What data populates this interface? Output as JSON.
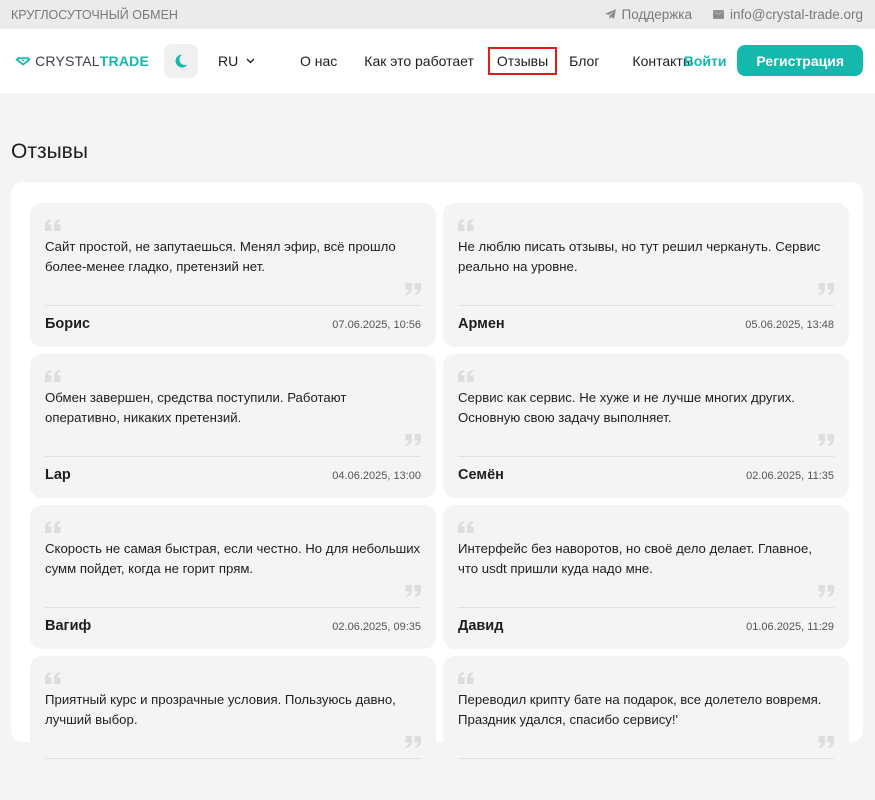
{
  "topbar": {
    "tagline": "КРУГЛОСУТОЧНЫЙ ОБМЕН",
    "support_label": "Поддержка",
    "email": "info@crystal-trade.org"
  },
  "header": {
    "brand_part1": "CRYSTAL",
    "brand_part2": "TRADE",
    "language": "RU",
    "nav": [
      "О нас",
      "Как это работает",
      "Отзывы",
      "Блог",
      "Контакты"
    ],
    "active_nav_index": 2,
    "login_label": "Войти",
    "register_label": "Регистрация"
  },
  "colors": {
    "accent": "#14b8ad",
    "highlight_border": "#e01b1b"
  },
  "page": {
    "title": "Отзывы"
  },
  "reviews": [
    {
      "text": "Сайт простой, не запутаешься. Менял эфир, всё прошло более-менее гладко, претензий нет.",
      "author": "Борис",
      "date": "07.06.2025, 10:56"
    },
    {
      "text": "Не люблю писать отзывы, но тут решил черкануть. Сервис реально на уровне.",
      "author": "Армен",
      "date": "05.06.2025, 13:48"
    },
    {
      "text": "Обмен завершен, средства поступили. Работают оперативно, никаких претензий.",
      "author": "Lap",
      "date": "04.06.2025, 13:00"
    },
    {
      "text": "Сервис как сервис. Не хуже и не лучше многих других. Основную свою задачу выполняет.",
      "author": "Семён",
      "date": "02.06.2025, 11:35"
    },
    {
      "text": "Скорость не самая быстрая, если честно. Но для небольших сумм пойдет, когда не горит прям.",
      "author": "Вагиф",
      "date": "02.06.2025, 09:35"
    },
    {
      "text": "Интерфейс без наворотов, но своё дело делает. Главное, что usdt пришли куда надо мне.",
      "author": "Давид",
      "date": "01.06.2025, 11:29"
    },
    {
      "text": "Приятный курс и прозрачные условия. Пользуюсь давно, лучший выбор.",
      "author": "",
      "date": ""
    },
    {
      "text": "Переводил крипту бате на подарок, все долетело вовремя. Праздник удался, спасибо сервису!'",
      "author": "",
      "date": ""
    }
  ]
}
